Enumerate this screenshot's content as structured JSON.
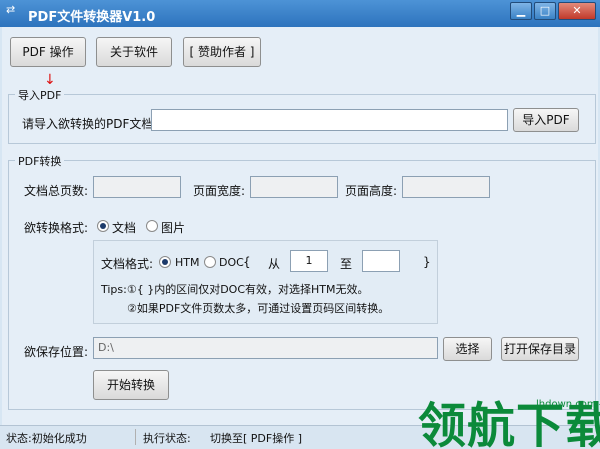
{
  "window": {
    "title": "PDF文件转换器V1.0"
  },
  "toolbar": {
    "pdf_ops": "PDF 操作",
    "about": "关于软件",
    "sponsor": "[ 赞助作者 ]"
  },
  "import_group": {
    "title": "导入PDF",
    "prompt_label": "请导入欲转换的PDF文档:",
    "path_value": "",
    "import_btn": "导入PDF"
  },
  "convert_group": {
    "title": "PDF转换",
    "total_pages_label": "文档总页数:",
    "page_width_label": "页面宽度:",
    "page_height_label": "页面高度:",
    "format_label": "欲转换格式:",
    "opt_document": "文档",
    "opt_image": "图片",
    "doc_format_label": "文档格式:",
    "opt_htm": "HTM",
    "opt_doc": "DOC",
    "brace_open": "{",
    "from_label": "从",
    "from_value": "1",
    "to_label": "至",
    "to_value": "",
    "brace_close": "}",
    "tip1": "Tips:①{ }内的区间仅对DOC有效，对选择HTM无效。",
    "tip2": "②如果PDF文件页数太多，可通过设置页码区间转换。",
    "save_label": "欲保存位置:",
    "save_path": "D:\\",
    "choose_btn": "选择",
    "open_dir_btn": "打开保存目录",
    "start_btn": "开始转换"
  },
  "status": {
    "state": "状态:初始化成功",
    "exec_label": "执行状态:",
    "exec_value": "切换至[ PDF操作 ]"
  },
  "watermark": {
    "text": "领航下载",
    "url": "lhdown.com"
  }
}
